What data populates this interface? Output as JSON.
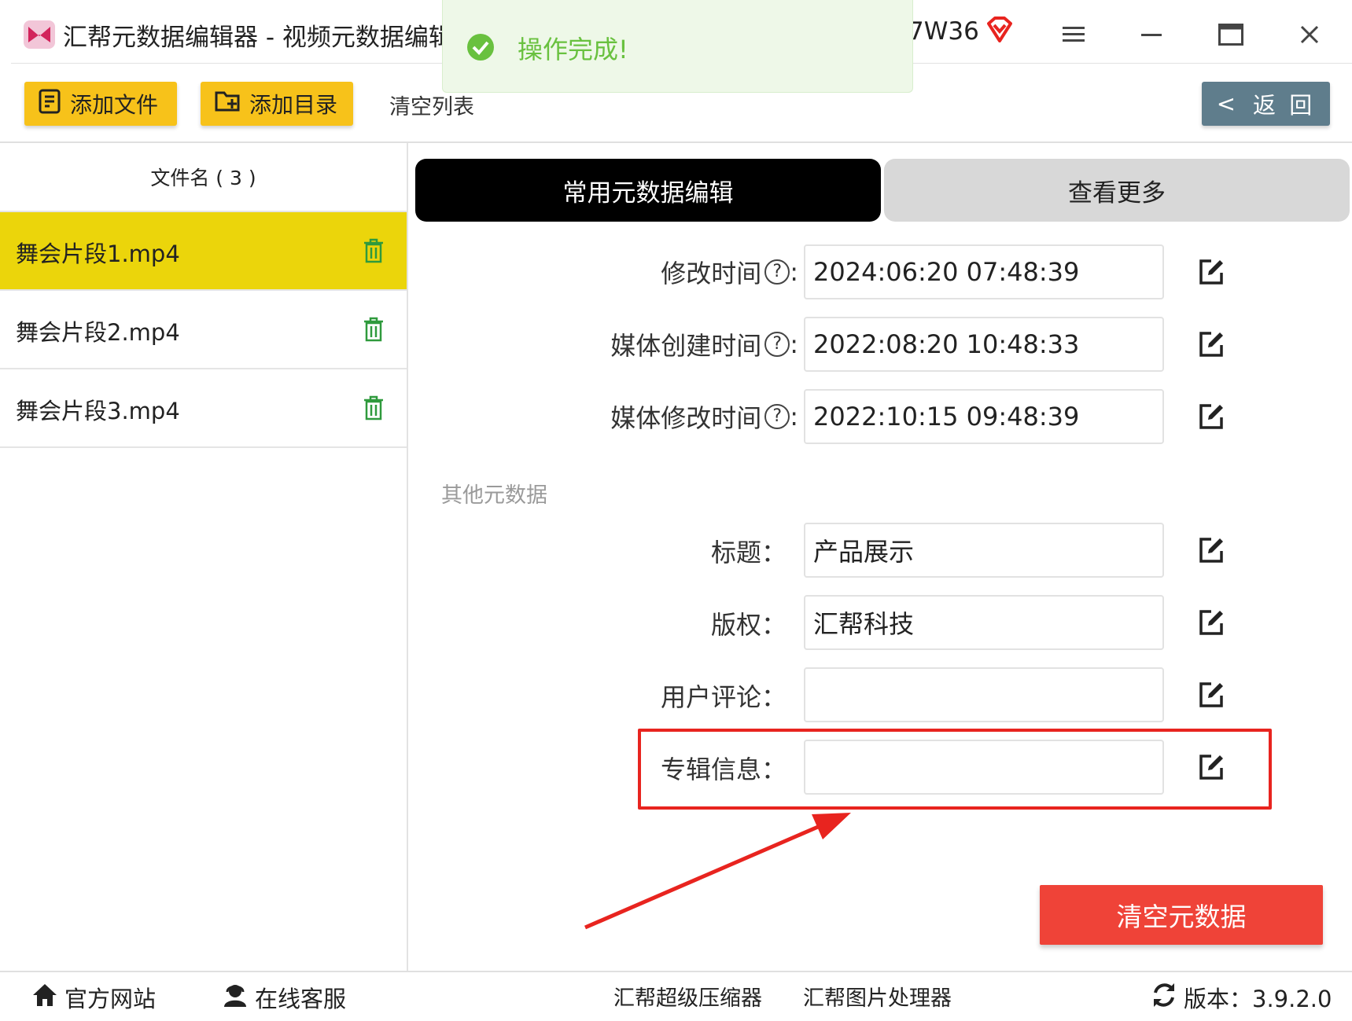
{
  "titlebar": {
    "title": "汇帮元数据编辑器 - 视频元数据编辑",
    "title_tail": "7W36"
  },
  "toast": {
    "message": "操作完成!"
  },
  "toolbar": {
    "add_file": "添加文件",
    "add_dir": "添加目录",
    "clear_list": "清空列表",
    "back": "返 回",
    "back_chevron": "<"
  },
  "file_list": {
    "header": "文件名 ( 3 )",
    "files": [
      {
        "name": "舞会片段1.mp4",
        "selected": true
      },
      {
        "name": "舞会片段2.mp4",
        "selected": false
      },
      {
        "name": "舞会片段3.mp4",
        "selected": false
      }
    ]
  },
  "tabs": {
    "common": "常用元数据编辑",
    "more": "查看更多"
  },
  "fields": {
    "modify_time": {
      "label": "修改时间",
      "help": "?",
      "value": "2024:06:20 07:48:39"
    },
    "media_create_time": {
      "label": "媒体创建时间",
      "help": "?",
      "value": "2022:08:20 10:48:33"
    },
    "media_modify_time": {
      "label": "媒体修改时间",
      "help": "?",
      "value": "2022:10:15 09:48:39"
    },
    "colon_help": ":",
    "section_other": "其他元数据",
    "title": {
      "label": "标题：",
      "value": "产品展示"
    },
    "copyright": {
      "label": "版权：",
      "value": "汇帮科技"
    },
    "comment": {
      "label": "用户评论：",
      "value": ""
    },
    "album": {
      "label": "专辑信息：",
      "value": ""
    }
  },
  "actions": {
    "clear_metadata": "清空元数据"
  },
  "footer": {
    "website": "官方网站",
    "support": "在线客服",
    "compressor": "汇帮超级压缩器",
    "image_tool": "汇帮图片处理器",
    "version": "版本：3.9.2.0"
  },
  "colors": {
    "accent_yellow": "#f7c21a",
    "selected_row": "#ebd50b",
    "back_button": "#5f7d8c",
    "danger_red": "#ef4338",
    "toast_green": "#69c13f",
    "highlight": "#e8241f"
  }
}
